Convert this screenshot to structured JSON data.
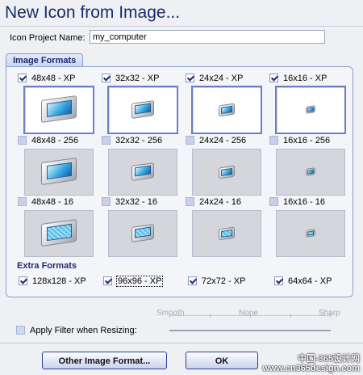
{
  "title": "New Icon from Image...",
  "project": {
    "label": "Icon Project Name:",
    "value": "my_computer"
  },
  "image_formats": {
    "tab_label": "Image Formats",
    "rows": [
      [
        {
          "label": "48x48 - XP",
          "checked": true
        },
        {
          "label": "32x32 - XP",
          "checked": true
        },
        {
          "label": "24x24 - XP",
          "checked": true
        },
        {
          "label": "16x16 - XP",
          "checked": true
        }
      ],
      [
        {
          "label": "48x48 - 256",
          "checked": false
        },
        {
          "label": "32x32 - 256",
          "checked": false
        },
        {
          "label": "24x24 - 256",
          "checked": false
        },
        {
          "label": "16x16 - 256",
          "checked": false
        }
      ],
      [
        {
          "label": "48x48 - 16",
          "checked": false
        },
        {
          "label": "32x32 - 16",
          "checked": false
        },
        {
          "label": "24x24 - 16",
          "checked": false
        },
        {
          "label": "16x16 - 16",
          "checked": false
        }
      ]
    ]
  },
  "extra_formats": {
    "title": "Extra Formats",
    "items": [
      {
        "label": "128x128 - XP",
        "checked": true
      },
      {
        "label": "96x96 - XP",
        "checked": true
      },
      {
        "label": "72x72 - XP",
        "checked": true
      },
      {
        "label": "64x64 - XP",
        "checked": true
      }
    ]
  },
  "filter": {
    "label": "Apply Filter when Resizing:",
    "checked": false,
    "scale": [
      "Smooth",
      "None",
      "Sharp"
    ]
  },
  "buttons": {
    "other": "Other Image Format...",
    "ok": "OK"
  },
  "watermark": {
    "line1": "中国-365设计网",
    "line2": "www.cn365design.com"
  }
}
